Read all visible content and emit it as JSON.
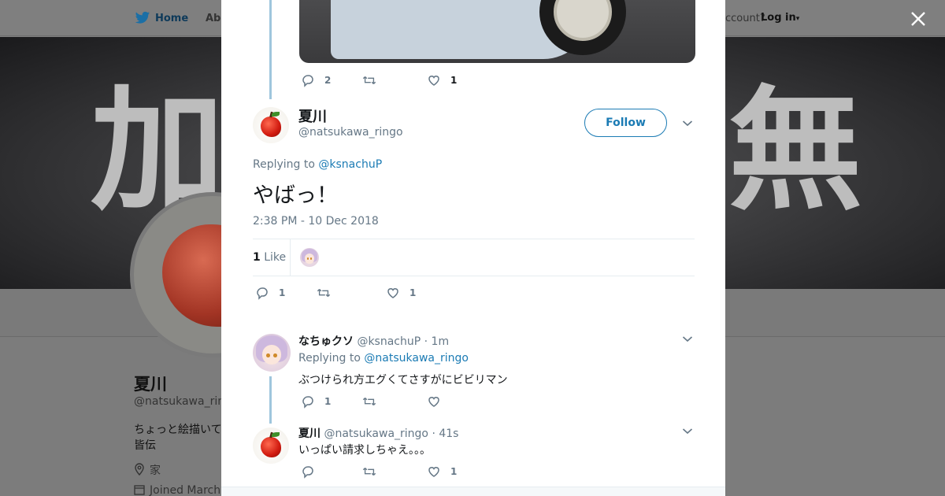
{
  "nav": {
    "home_label": "Home",
    "about_label": "Abo",
    "account_prompt": "ccount?",
    "login_label": "Log in"
  },
  "banner": {
    "left_text": "加",
    "right_text": "無"
  },
  "profile": {
    "name": "夏川",
    "handle": "@natsukawa_ring",
    "bio_line1": "ちょっと絵描いて",
    "bio_line2": "皆伝",
    "location": "家",
    "joined": "Joined March"
  },
  "prev_tweet": {
    "reply_count": "2",
    "retweet_count": "",
    "like_count": "1"
  },
  "main_tweet": {
    "name": "夏川",
    "handle": "@natsukawa_ringo",
    "follow_label": "Follow",
    "replying_prefix": "Replying to",
    "replying_to": "@ksnachuP",
    "text": "やばっ！",
    "timestamp": "2:38 PM - 10 Dec 2018",
    "likes_count": "1",
    "likes_label": "Like",
    "reply_count": "1",
    "retweet_count": "",
    "like_count": "1"
  },
  "replies": [
    {
      "name": "なちゅクソ",
      "handle": "@ksnachuP",
      "time": "· 1m",
      "replying_prefix": "Replying to",
      "replying_to": "@natsukawa_ringo",
      "text": "ぶつけられ方エグくてさすがにビビリマン",
      "reply_count": "1",
      "retweet_count": "",
      "like_count": ""
    },
    {
      "name": "夏川",
      "handle": "@natsukawa_ringo",
      "time": "· 41s",
      "text": "いっぱい請求しちゃえ。。。",
      "reply_count": "",
      "retweet_count": "",
      "like_count": "1"
    }
  ],
  "colors": {
    "link": "#1b7bb4",
    "muted": "#657786",
    "thread_line": "#9fc6dd",
    "overlay": "#808080"
  },
  "icons": [
    "twitter-bird-icon",
    "close-icon",
    "reply-icon",
    "retweet-icon",
    "like-icon",
    "chevron-down-icon",
    "location-icon",
    "calendar-icon"
  ]
}
